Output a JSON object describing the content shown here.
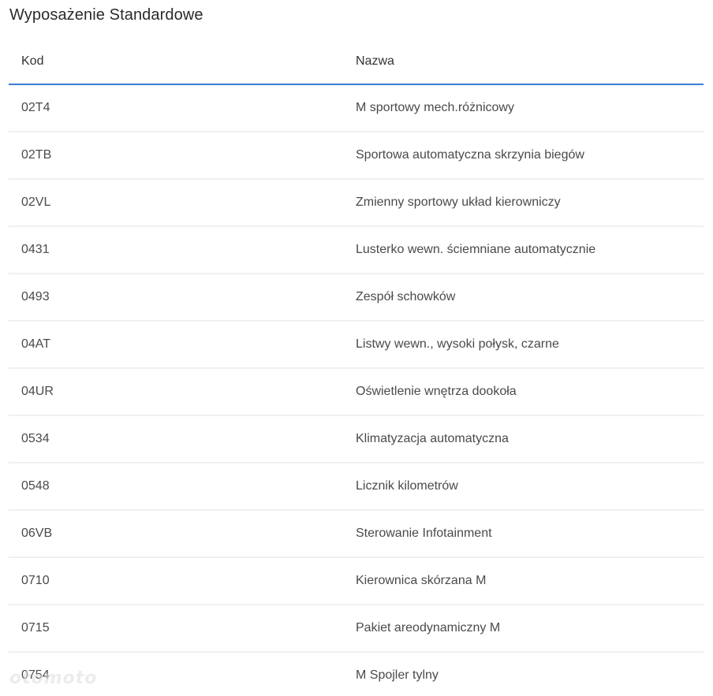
{
  "page": {
    "title": "Wyposażenie Standardowe"
  },
  "table": {
    "columns": [
      "Kod",
      "Nazwa"
    ],
    "rows": [
      {
        "kod": "02T4",
        "nazwa": "M sportowy mech.różnicowy"
      },
      {
        "kod": "02TB",
        "nazwa": "Sportowa automatyczna skrzynia biegów"
      },
      {
        "kod": "02VL",
        "nazwa": "Zmienny sportowy układ kierowniczy"
      },
      {
        "kod": "0431",
        "nazwa": "Lusterko wewn. ściemniane automatycznie"
      },
      {
        "kod": "0493",
        "nazwa": "Zespół schowków"
      },
      {
        "kod": "04AT",
        "nazwa": "Listwy wewn., wysoki połysk, czarne"
      },
      {
        "kod": "04UR",
        "nazwa": "Oświetlenie wnętrza dookoła"
      },
      {
        "kod": "0534",
        "nazwa": "Klimatyzacja automatyczna"
      },
      {
        "kod": "0548",
        "nazwa": "Licznik kilometrów"
      },
      {
        "kod": "06VB",
        "nazwa": "Sterowanie Infotainment"
      },
      {
        "kod": "0710",
        "nazwa": "Kierownica skórzana M"
      },
      {
        "kod": "0715",
        "nazwa": "Pakiet areodynamiczny M"
      },
      {
        "kod": "0754",
        "nazwa": "M Spojler tylny"
      }
    ]
  },
  "watermark": {
    "text": "otomoto"
  },
  "colors": {
    "header_underline": "#3b7dd8",
    "row_divider": "#f0f0f0"
  }
}
